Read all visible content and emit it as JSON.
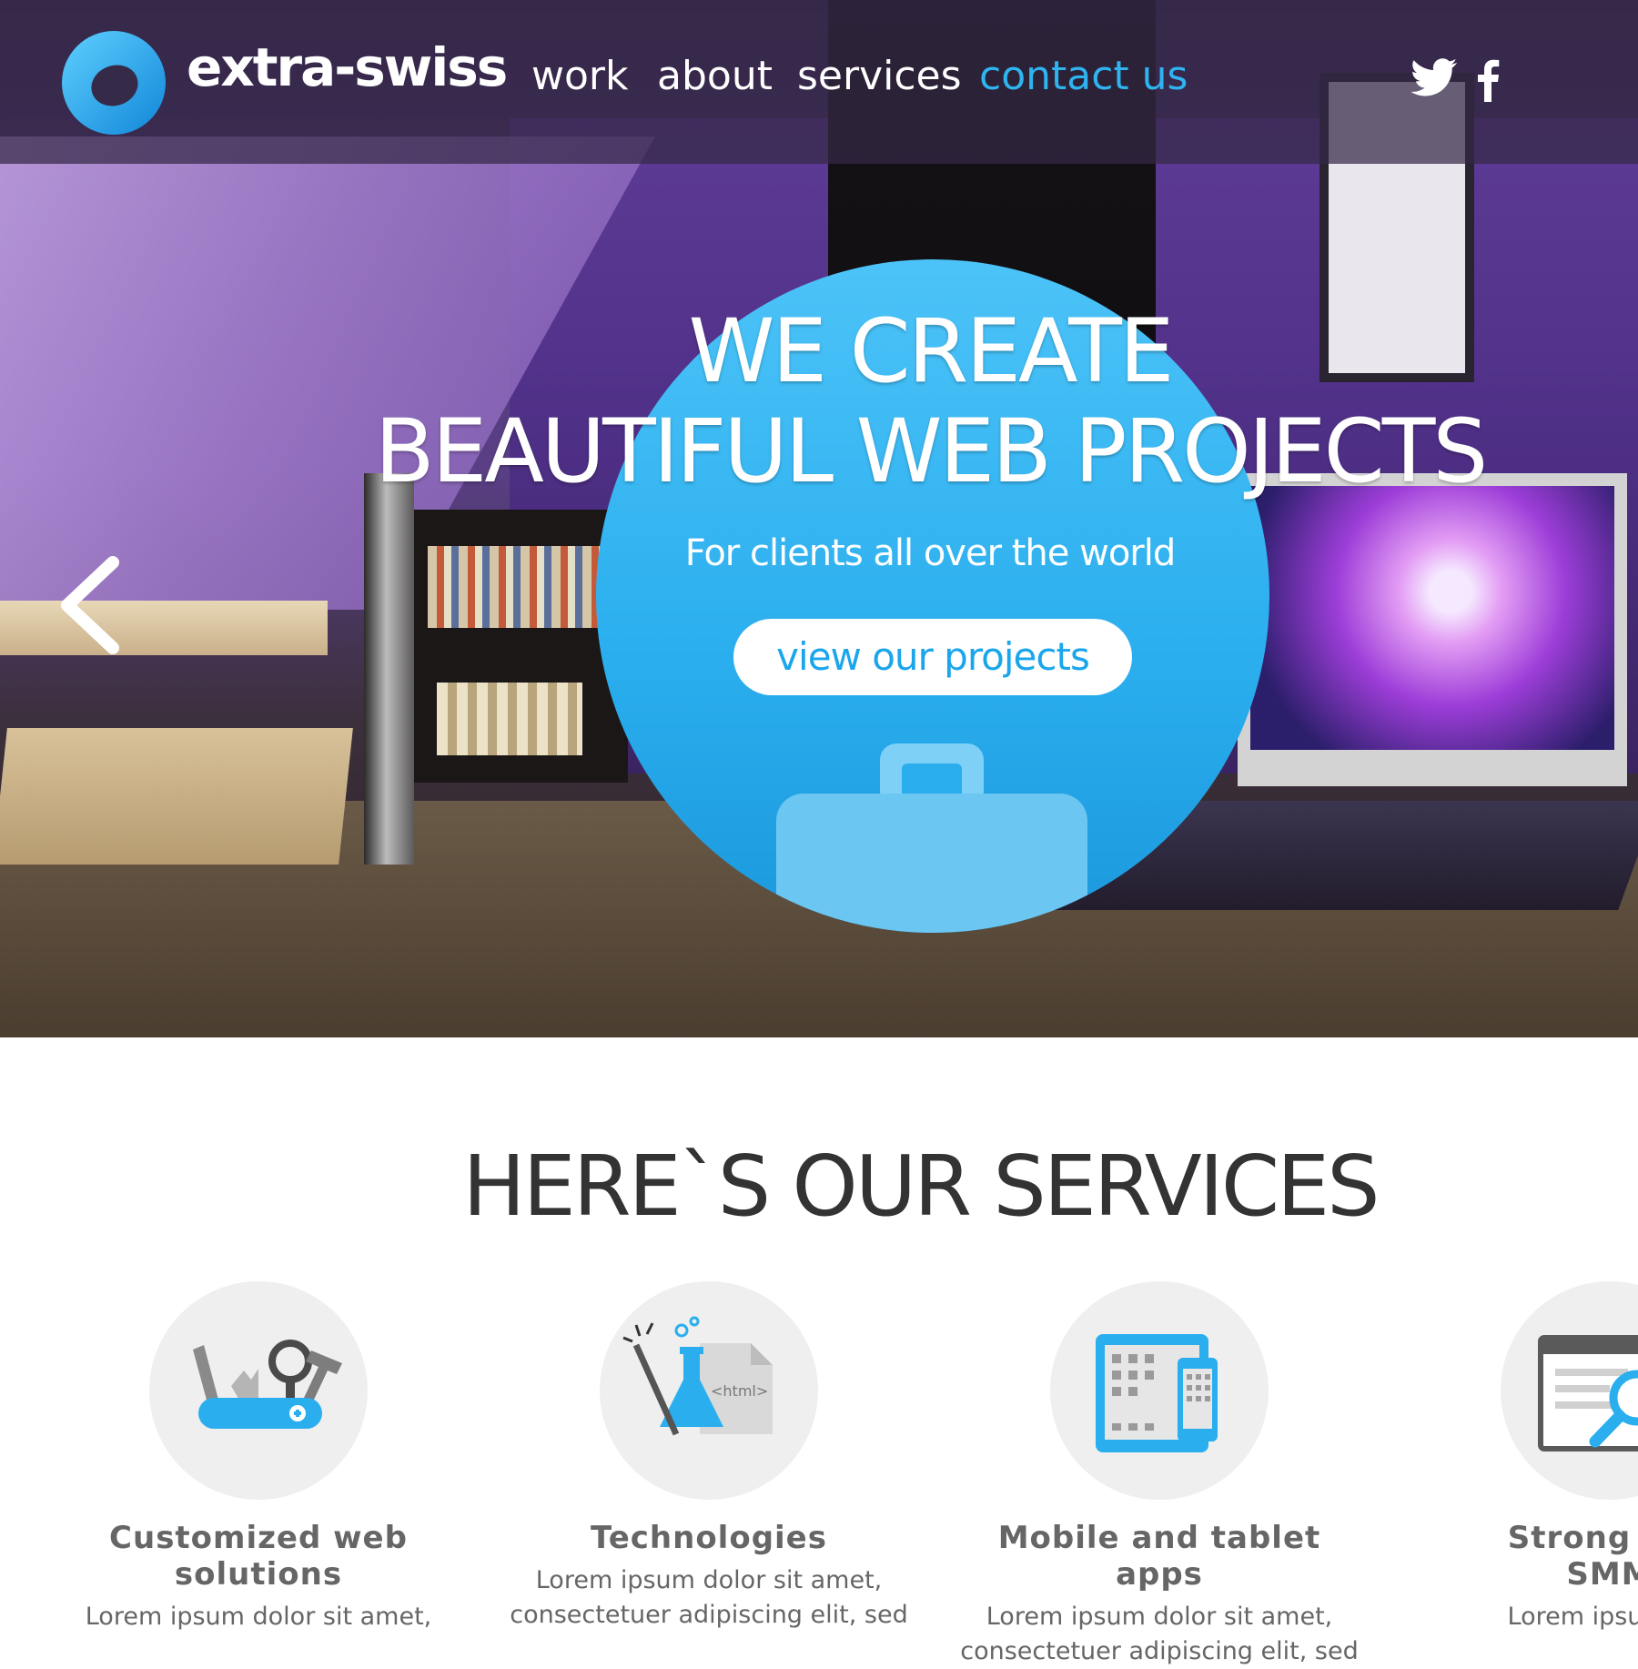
{
  "brand": {
    "name": "extra-swiss",
    "accent": "#2fb4f0"
  },
  "nav": {
    "items": [
      {
        "label": "work"
      },
      {
        "label": "about"
      },
      {
        "label": "services"
      },
      {
        "label": "contact us",
        "active": true
      }
    ],
    "social": [
      "twitter-icon",
      "facebook-icon"
    ]
  },
  "hero": {
    "title_line1": "WE CREATE",
    "title_line2": "BEAUTIFUL WEB PROJECTS",
    "subtitle": "For clients all over the world",
    "cta_label": "view our projects",
    "prev_icon": "chevron-left-icon"
  },
  "services": {
    "title": "HERE`S OUR SERVICES",
    "items": [
      {
        "icon": "swiss-knife-icon",
        "title_line1": "Customized web",
        "title_line2": "solutions",
        "text_line1": "Lorem ipsum dolor sit amet,",
        "text_line2": ""
      },
      {
        "icon": "flask-html-icon",
        "title_line1": "Technologies",
        "title_line2": "",
        "text_line1": "Lorem ipsum dolor sit amet,",
        "text_line2": "consectetuer adipiscing elit, sed"
      },
      {
        "icon": "devices-icon",
        "title_line1": "Mobile and tablet apps",
        "title_line2": "",
        "text_line1": "Lorem ipsum dolor sit amet,",
        "text_line2": "consectetuer adipiscing elit, sed"
      },
      {
        "icon": "browser-search-icon",
        "title_line1": "Strong in S",
        "title_line2": "SMM",
        "text_line1": "Lorem ipsum dol",
        "text_line2": ""
      }
    ]
  }
}
